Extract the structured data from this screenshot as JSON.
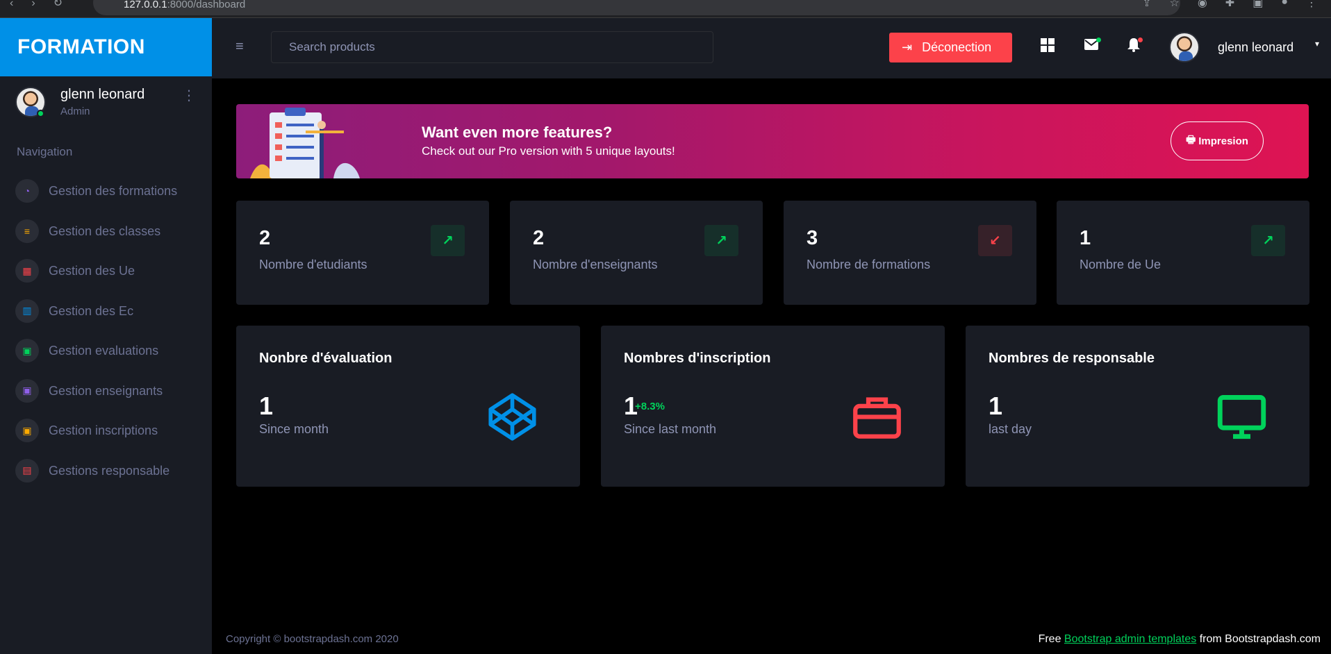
{
  "browser": {
    "url_host": "127.0.0.1",
    "url_rest": ":8000/dashboard"
  },
  "sidebar": {
    "brand": "FORMATION",
    "profile": {
      "name": "glenn leonard",
      "role": "Admin"
    },
    "nav_title": "Navigation",
    "items": [
      {
        "label": "Gestion des formations",
        "icon": "speedometer-icon",
        "color": "#8f5fe8"
      },
      {
        "label": "Gestion des classes",
        "icon": "playlist-icon",
        "color": "#ffab00"
      },
      {
        "label": "Gestion des Ue",
        "icon": "table-icon",
        "color": "#fc424a"
      },
      {
        "label": "Gestion des Ec",
        "icon": "chart-bar-icon",
        "color": "#0090e7"
      },
      {
        "label": "Gestion evaluations",
        "icon": "contacts-icon",
        "color": "#00d25b"
      },
      {
        "label": "Gestion enseignants",
        "icon": "contacts-icon",
        "color": "#8f5fe8"
      },
      {
        "label": "Gestion inscriptions",
        "icon": "contacts-icon",
        "color": "#ffab00"
      },
      {
        "label": "Gestions responsable",
        "icon": "file-document-icon",
        "color": "#fc424a"
      }
    ]
  },
  "topbar": {
    "search_placeholder": "Search products",
    "logout_label": "Déconection",
    "user_name": "glenn leonard"
  },
  "promo": {
    "title": "Want even more features?",
    "subtitle": "Check out our Pro version with 5 unique layouts!",
    "button": "Impresion"
  },
  "stats": [
    {
      "value": "2",
      "label": "Nombre d'etudiants",
      "trend": "up"
    },
    {
      "value": "2",
      "label": "Nombre d'enseignants",
      "trend": "up"
    },
    {
      "value": "3",
      "label": "Nombre de formations",
      "trend": "down"
    },
    {
      "value": "1",
      "label": "Nombre de Ue",
      "trend": "up"
    }
  ],
  "cards": [
    {
      "title": "Nonbre d'évaluation",
      "value": "1",
      "delta": "",
      "sub": "Since month",
      "icon": "codepen-icon",
      "color": "#0090e7"
    },
    {
      "title": "Nombres d'inscription",
      "value": "1",
      "delta": "+8.3%",
      "sub": "Since last month",
      "icon": "briefcase-icon",
      "color": "#fc424a"
    },
    {
      "title": "Nombres de responsable",
      "value": "1",
      "delta": "",
      "sub": "last day",
      "icon": "monitor-icon",
      "color": "#00d25b"
    }
  ],
  "footer": {
    "copyright": "Copyright © bootstrapdash.com 2020",
    "free_prefix": "Free ",
    "link_text": "Bootstrap admin templates",
    "suffix": " from Bootstrapdash.com"
  }
}
